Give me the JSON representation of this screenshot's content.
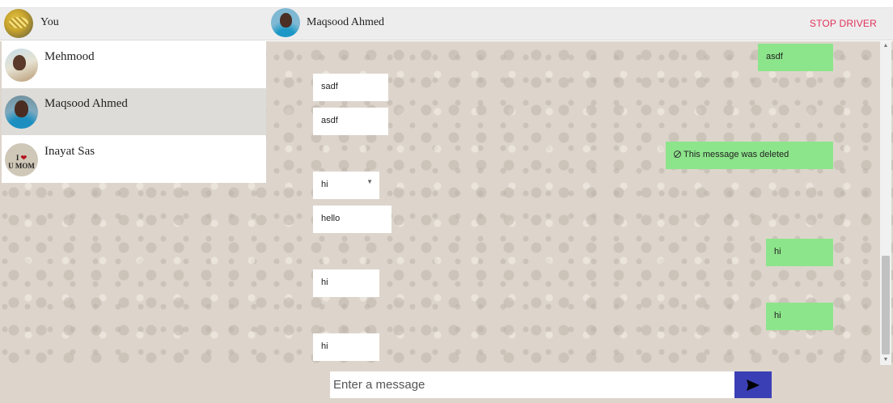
{
  "header": {
    "me_name": "You",
    "contact_name": "Maqsood Ahmed",
    "stop_label": "STOP DRIVER"
  },
  "contacts": [
    {
      "name": "Mehmood",
      "active": false
    },
    {
      "name": "Maqsood Ahmed",
      "active": true
    },
    {
      "name": "Inayat Sas",
      "active": false,
      "avatar_text": "I ❤ U MOM"
    }
  ],
  "messages": [
    {
      "side": "out",
      "text": "asdf"
    },
    {
      "side": "in",
      "text": "sadf"
    },
    {
      "side": "in",
      "text": "asdf"
    },
    {
      "side": "out",
      "text": "This message was deleted",
      "deleted": true
    },
    {
      "side": "in",
      "text": "hi",
      "has_menu": true
    },
    {
      "side": "in",
      "text": "hello"
    },
    {
      "side": "out",
      "text": "hi"
    },
    {
      "side": "in",
      "text": "hi"
    },
    {
      "side": "out",
      "text": "hi"
    },
    {
      "side": "in",
      "text": "hi"
    }
  ],
  "composer": {
    "placeholder": "Enter a message"
  },
  "colors": {
    "outgoing_bubble": "#8de58b",
    "incoming_bubble": "#ffffff",
    "stop_text": "#e0325a",
    "send_button": "#3b3fb5",
    "chat_background": "#ddd5cc"
  },
  "icons": {
    "send": "send-icon",
    "deleted": "prohibited-icon",
    "menu": "chevron-down-icon"
  }
}
